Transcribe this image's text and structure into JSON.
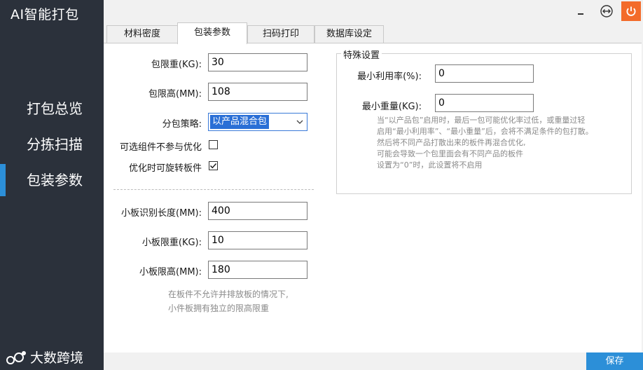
{
  "app": {
    "title": "AI智能打包"
  },
  "sidebar": {
    "items": [
      {
        "label": "打包总览"
      },
      {
        "label": "分拣扫描"
      },
      {
        "label": "包装参数",
        "active": true
      }
    ],
    "brand": "大数跨境"
  },
  "tabs": [
    {
      "label": "材料密度"
    },
    {
      "label": "包装参数",
      "active": true
    },
    {
      "label": "扫码打印"
    },
    {
      "label": "数据库设定"
    }
  ],
  "form": {
    "weight_limit": {
      "label": "包限重(KG):",
      "value": "30"
    },
    "height_limit": {
      "label": "包限高(MM):",
      "value": "108"
    },
    "strategy": {
      "label": "分包策略:",
      "value": "以产品混合包"
    },
    "optional_parts": {
      "label": "可选组件不参与优化",
      "checked": false
    },
    "rotate_boards": {
      "label": "优化时可旋转板件",
      "checked": true
    },
    "small_board_length": {
      "label": "小板识别长度(MM):",
      "value": "400"
    },
    "small_board_weight": {
      "label": "小板限重(KG):",
      "value": "10"
    },
    "small_board_height": {
      "label": "小板限高(MM):",
      "value": "180"
    },
    "small_board_hint": [
      "在板件不允许并排放板的情况下,",
      "小件板拥有独立的限高限重"
    ]
  },
  "special": {
    "title": "特殊设置",
    "min_utilization": {
      "label": "最小利用率(%):",
      "value": "0"
    },
    "min_weight": {
      "label": "最小重量(KG):",
      "value": "0"
    },
    "hint": [
      "当“以产品包”启用时，最后一包可能优化率过低，或重量过轻",
      "启用“最小利用率”、“最小重量”后，会将不满足条件的包打散。",
      "然后将不同产品打散出来的板件再混合优化,",
      "可能会导致一个包里面会有不同产品的板件",
      "设置为“0”时，此设置将不启用"
    ]
  },
  "footer": {
    "save_label": "保存"
  },
  "colors": {
    "sidebar_bg": "#2b313b",
    "accent": "#2c8fd8",
    "power_btn": "#f36b2a",
    "selection": "#2a6fd6"
  },
  "icons": {
    "window_resize": "resize-icon",
    "power": "power-icon",
    "checkmark": "checkmark-icon",
    "chevron": "chevron-down-icon"
  }
}
